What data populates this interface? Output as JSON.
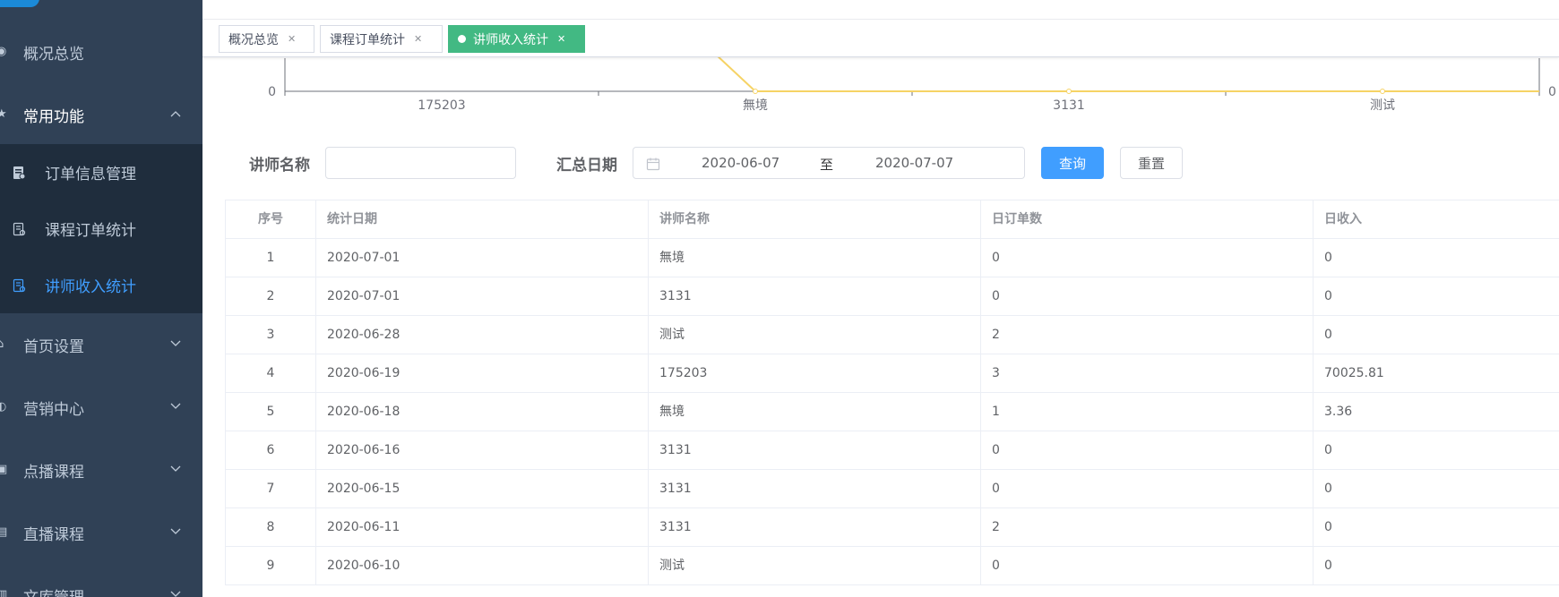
{
  "sidebar": {
    "items": [
      {
        "label": "概况总览",
        "icon": "dashboard-icon"
      },
      {
        "label": "常用功能",
        "icon": "star-icon",
        "expanded": true
      },
      {
        "label": "首页设置",
        "icon": "home-icon"
      },
      {
        "label": "营销中心",
        "icon": "marketing-icon"
      },
      {
        "label": "点播课程",
        "icon": "video-icon"
      },
      {
        "label": "直播课程",
        "icon": "live-icon"
      },
      {
        "label": "文库管理",
        "icon": "library-icon"
      }
    ],
    "submenu": [
      {
        "label": "订单信息管理",
        "icon": "order-icon"
      },
      {
        "label": "课程订单统计",
        "icon": "report-icon"
      },
      {
        "label": "讲师收入统计",
        "icon": "report-icon",
        "active": true
      }
    ]
  },
  "tags": [
    {
      "label": "概况总览"
    },
    {
      "label": "课程订单统计"
    },
    {
      "label": "讲师收入统计",
      "active": true
    }
  ],
  "chart_data": {
    "type": "line",
    "categories": [
      "175203",
      "無境",
      "3131",
      "测试"
    ],
    "values": [
      null,
      0,
      0,
      0
    ],
    "ylabel_left_tick": "0",
    "ylabel_right_tick": "0",
    "line_color": "#f6d365"
  },
  "filter": {
    "teacher_label": "讲师名称",
    "teacher_value": "",
    "date_label": "汇总日期",
    "date_start": "2020-06-07",
    "date_sep": "至",
    "date_end": "2020-07-07",
    "query_button": "查询",
    "reset_button": "重置"
  },
  "table": {
    "headers": [
      "序号",
      "统计日期",
      "讲师名称",
      "日订单数",
      "日收入"
    ],
    "rows": [
      [
        "1",
        "2020-07-01",
        "無境",
        "0",
        "0"
      ],
      [
        "2",
        "2020-07-01",
        "3131",
        "0",
        "0"
      ],
      [
        "3",
        "2020-06-28",
        "测试",
        "2",
        "0"
      ],
      [
        "4",
        "2020-06-19",
        "175203",
        "3",
        "70025.81"
      ],
      [
        "5",
        "2020-06-18",
        "無境",
        "1",
        "3.36"
      ],
      [
        "6",
        "2020-06-16",
        "3131",
        "0",
        "0"
      ],
      [
        "7",
        "2020-06-15",
        "3131",
        "0",
        "0"
      ],
      [
        "8",
        "2020-06-11",
        "3131",
        "2",
        "0"
      ],
      [
        "9",
        "2020-06-10",
        "测试",
        "0",
        "0"
      ]
    ]
  },
  "colors": {
    "sidebar_bg": "#304156",
    "submenu_bg": "#1f2d3d",
    "active_menu": "#409eff",
    "active_tag": "#42b983",
    "primary_button": "#409eff"
  }
}
